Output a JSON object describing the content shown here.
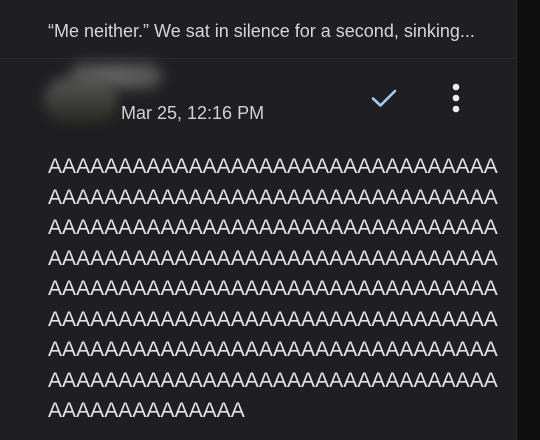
{
  "preview_text": "“Me neither.” We sat in silence for a second, sinking...",
  "comment": {
    "date": "Mar 25, 12:16 PM",
    "lines": [
      "AAAAAAAAAAAAAAAAAAAAAAAAAAAAAAAA",
      "AAAAAAAAAAAAAAAAAAAAAAAAAAAAAAAA",
      "AAAAAAAAAAAAAAAAAAAAAAAAAAAAAAAA",
      "AAAAAAAAAAAAAAAAAAAAAAAAAAAAAAAA",
      "AAAAAAAAAAAAAAAAAAAAAAAAAAAAAAAA",
      "AAAAAAAAAAAAAAAAAAAAAAAAAAAAAAAA",
      "AAAAAAAAAAAAAAAAAAAAAAAAAAAAAAAA",
      "AAAAAAAAAAAAAAAAAAAAAAAAAAAAAAAA",
      "AAAAAAAAAAAAAA"
    ]
  },
  "icons": {
    "resolve": "check-icon",
    "more": "more-vert-icon"
  },
  "colors": {
    "background": "#1f1f22",
    "accent": "#a8c7fa",
    "text": "#e2e2e2"
  }
}
